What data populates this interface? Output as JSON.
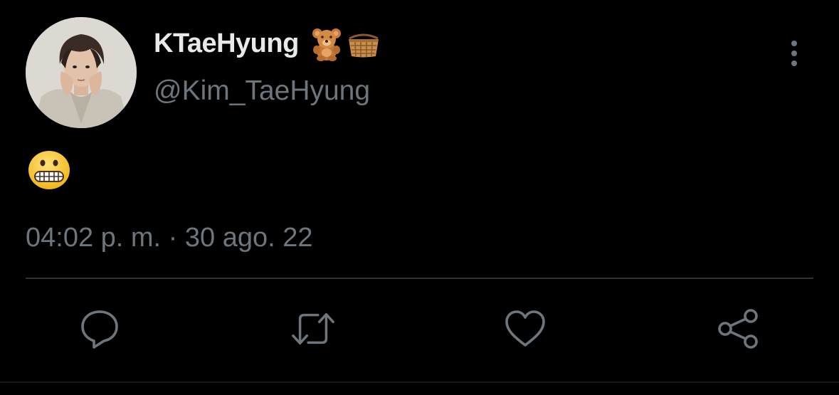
{
  "tweet": {
    "author": {
      "display_name": "KTaeHyung",
      "name_emojis": [
        "teddy-bear",
        "basket"
      ],
      "handle": "@Kim_TaeHyung"
    },
    "body_emoji": "grimacing-face",
    "timestamp": "04:02 p. m. · 30 ago. 22"
  },
  "actions": [
    {
      "name": "reply",
      "icon": "reply-icon"
    },
    {
      "name": "retweet",
      "icon": "retweet-icon"
    },
    {
      "name": "like",
      "icon": "heart-icon"
    },
    {
      "name": "share",
      "icon": "share-icon"
    }
  ],
  "colors": {
    "background": "#000000",
    "text_primary": "#e7e9ea",
    "text_secondary": "#6e767d",
    "divider": "#2f3336"
  }
}
